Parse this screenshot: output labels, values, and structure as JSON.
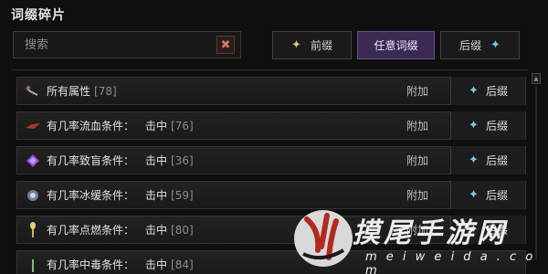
{
  "panel": {
    "title": "词缀碎片"
  },
  "search": {
    "placeholder": "搜索",
    "value": "",
    "clear_symbol": "✖"
  },
  "filters": [
    {
      "label": "前缀",
      "icon": "gold-star-icon",
      "active": false
    },
    {
      "label": "任意词缀",
      "active": true
    },
    {
      "label": "后缀",
      "icon": "blue-star-icon",
      "active": false
    }
  ],
  "rows": [
    {
      "name": "所有属性",
      "condition": "",
      "count": "[78]",
      "action": "附加",
      "type": "后缀",
      "icon": "key-icon"
    },
    {
      "name": "有几率流血条件：",
      "condition": "击中",
      "count": "[76]",
      "action": "附加",
      "type": "后缀",
      "icon": "blood-shard-icon"
    },
    {
      "name": "有几率致盲条件：",
      "condition": "击中",
      "count": "[36]",
      "action": "附加",
      "type": "后缀",
      "icon": "purple-gem-icon"
    },
    {
      "name": "有几率冰缓条件：",
      "condition": "击中",
      "count": "[59]",
      "action": "附加",
      "type": "后缀",
      "icon": "frost-gem-icon"
    },
    {
      "name": "有几率点燃条件：",
      "condition": "击中",
      "count": "[80]",
      "action": "附加",
      "type": "后缀",
      "icon": "torch-icon"
    },
    {
      "name": "有几率中毒条件：",
      "condition": "击中",
      "count": "[84]",
      "action": "",
      "type": "",
      "icon": "poison-icon"
    }
  ],
  "colors": {
    "accent_active": "#3b2a52",
    "prefix_star": "#e0c282",
    "suffix_star": "#77c6e6"
  },
  "watermark": {
    "text": "摸尾手游网",
    "sub": "m e i w e i d a . c o m"
  }
}
